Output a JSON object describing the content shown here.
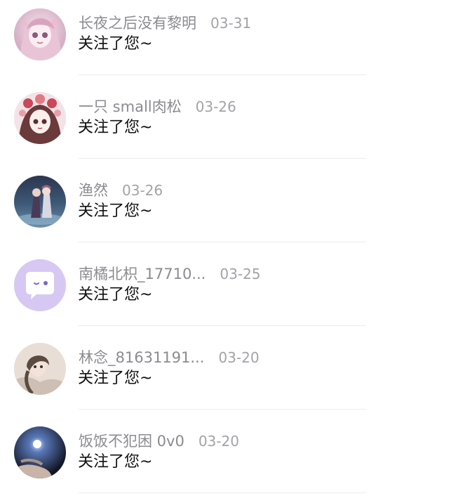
{
  "notifications": [
    {
      "name": "长夜之后没有黎明",
      "date": "03-31",
      "message": "关注了您~",
      "avatar": "anime-girl-pink-avatar"
    },
    {
      "name": "一只 small肉松",
      "date": "03-26",
      "message": "关注了您~",
      "avatar": "anime-girl-floral-avatar"
    },
    {
      "name": "渔然",
      "date": "03-26",
      "message": "关注了您~",
      "avatar": "anime-couple-water-avatar"
    },
    {
      "name": "南橘北枳_17710...",
      "date": "03-25",
      "message": "关注了您~",
      "avatar": "default-chat-bubble-avatar"
    },
    {
      "name": "林念_81631191...",
      "date": "03-20",
      "message": "关注了您~",
      "avatar": "photo-girl-avatar"
    },
    {
      "name": "饭饭不犯困 0v0",
      "date": "03-20",
      "message": "关注了您~",
      "avatar": "hand-light-avatar"
    }
  ]
}
